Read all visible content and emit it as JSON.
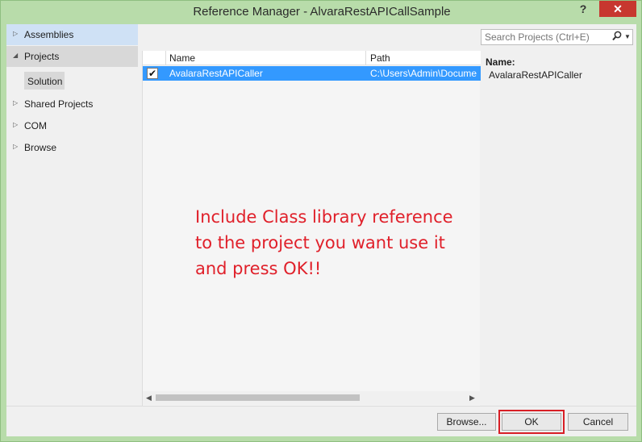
{
  "window": {
    "title": "Reference Manager - AlvaraRestAPICallSample",
    "help_glyph": "?",
    "close_glyph": "✕"
  },
  "sidebar": {
    "items": [
      {
        "label": "Assemblies",
        "arrow": "▷",
        "state": "highlighted"
      },
      {
        "label": "Projects",
        "arrow": "◢",
        "state": "expanded"
      },
      {
        "label": "Shared Projects",
        "arrow": "▷",
        "state": "normal"
      },
      {
        "label": "COM",
        "arrow": "▷",
        "state": "normal"
      },
      {
        "label": "Browse",
        "arrow": "▷",
        "state": "normal"
      }
    ],
    "sub_item": {
      "label": "Solution",
      "state": "selected"
    }
  },
  "grid": {
    "columns": [
      "Name",
      "Path"
    ],
    "rows": [
      {
        "checked": true,
        "check_glyph": "✔",
        "name": "AvalaraRestAPICaller",
        "path": "C:\\Users\\Admin\\Docume"
      }
    ]
  },
  "annotation": "Include Class library reference to the project you want use it and press OK!!",
  "search": {
    "placeholder": "Search Projects (Ctrl+E)",
    "value": "",
    "icon": "search-icon",
    "dropdown_glyph": "▼"
  },
  "details": {
    "name_label": "Name:",
    "name_value": "AvalaraRestAPICaller"
  },
  "scrollbar": {
    "left_glyph": "◀",
    "right_glyph": "▶"
  },
  "buttons": {
    "browse": "Browse...",
    "ok": "OK",
    "cancel": "Cancel"
  },
  "colors": {
    "selection": "#3399ff",
    "annotation": "#e0202a",
    "close": "#c7372f",
    "frame": "#b8dcaa"
  }
}
